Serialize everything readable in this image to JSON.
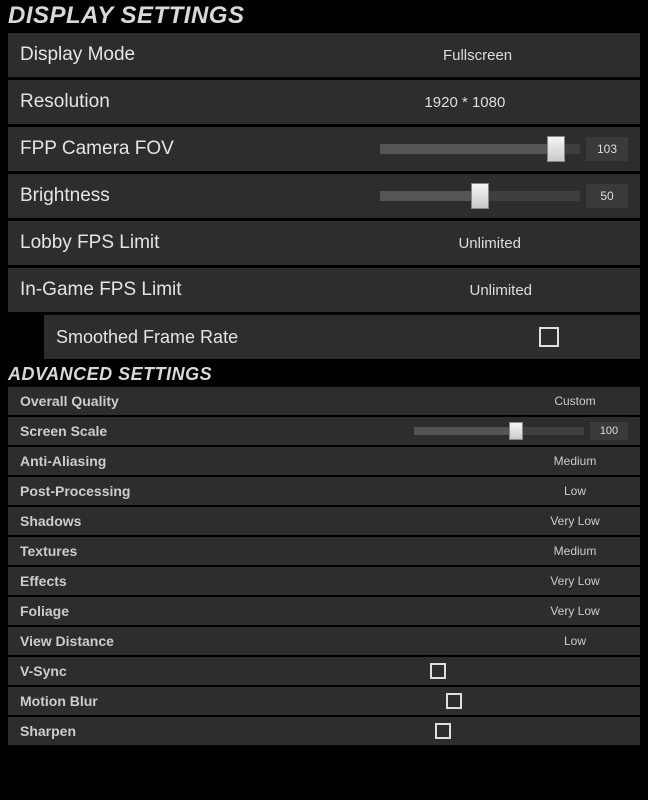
{
  "display": {
    "header": "DISPLAY SETTINGS",
    "rows": {
      "display_mode": {
        "label": "Display Mode",
        "value": "Fullscreen"
      },
      "resolution": {
        "label": "Resolution",
        "value": "1920 * 1080"
      },
      "fpp_fov": {
        "label": "FPP Camera FOV",
        "value": "103",
        "pct": 88
      },
      "brightness": {
        "label": "Brightness",
        "value": "50",
        "pct": 50
      },
      "lobby_fps": {
        "label": "Lobby FPS Limit",
        "value": "Unlimited"
      },
      "ingame_fps": {
        "label": "In-Game FPS Limit",
        "value": "Unlimited"
      },
      "smoothed_fr": {
        "label": "Smoothed Frame Rate",
        "checked": false
      }
    }
  },
  "advanced": {
    "header": "ADVANCED SETTINGS",
    "rows": {
      "overall_quality": {
        "label": "Overall Quality",
        "value": "Custom"
      },
      "screen_scale": {
        "label": "Screen Scale",
        "value": "100",
        "pct": 60
      },
      "anti_aliasing": {
        "label": "Anti-Aliasing",
        "value": "Medium"
      },
      "post_processing": {
        "label": "Post-Processing",
        "value": "Low"
      },
      "shadows": {
        "label": "Shadows",
        "value": "Very Low"
      },
      "textures": {
        "label": "Textures",
        "value": "Medium"
      },
      "effects": {
        "label": "Effects",
        "value": "Very Low"
      },
      "foliage": {
        "label": "Foliage",
        "value": "Very Low"
      },
      "view_distance": {
        "label": "View Distance",
        "value": "Low"
      },
      "vsync": {
        "label": "V-Sync",
        "checked": false
      },
      "motion_blur": {
        "label": "Motion Blur",
        "checked": false
      },
      "sharpen": {
        "label": "Sharpen",
        "checked": false
      }
    }
  }
}
